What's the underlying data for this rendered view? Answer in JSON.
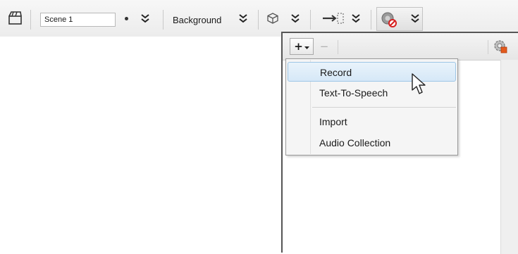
{
  "toolbar": {
    "scene_name": "Scene 1",
    "background_label": "Background",
    "icons": [
      "clapperboard-icon",
      "more-chevron-icon",
      "more-chevron-icon",
      "cube-icon",
      "more-chevron-icon",
      "motion-path-icon",
      "more-chevron-icon",
      "audio-muted-icon",
      "more-chevron-icon"
    ]
  },
  "audio_panel": {
    "add_label": "+",
    "remove_label": "−",
    "menu": {
      "items": [
        "Record",
        "Text-To-Speech",
        "Import",
        "Audio Collection"
      ],
      "highlighted": "Record"
    }
  },
  "colors": {
    "highlight": "#d6e8f7",
    "highlight_border": "#9ec6e6",
    "mute_red": "#d61f1f"
  }
}
